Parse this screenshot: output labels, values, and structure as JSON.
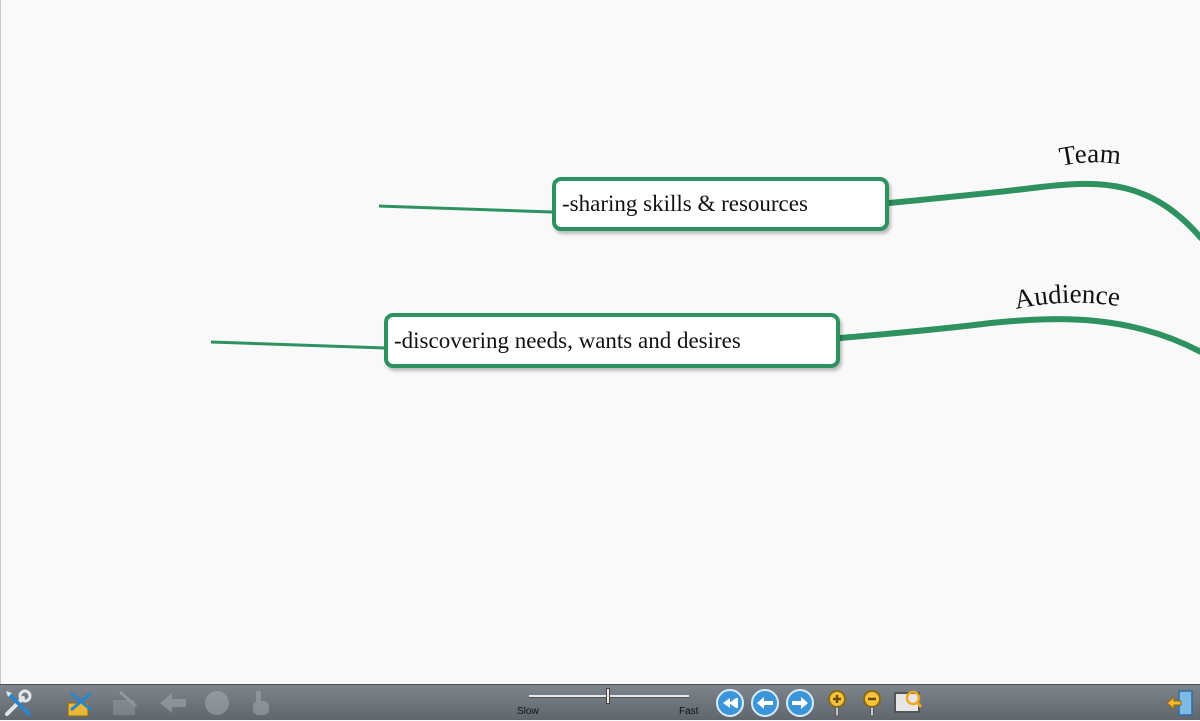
{
  "mindmap": {
    "branches": [
      {
        "label": "Team",
        "subtopic": "-sharing skills & resources"
      },
      {
        "label": "Audience",
        "subtopic": "-discovering needs, wants and desires"
      }
    ],
    "branch_color": "#2e9160"
  },
  "toolbar": {
    "buttons": [
      {
        "icon": "tools-icon"
      },
      {
        "icon": "map-edit-icon"
      },
      {
        "icon": "folder-icon"
      },
      {
        "icon": "arrow-left-icon"
      },
      {
        "icon": "circle-icon"
      },
      {
        "icon": "hand-pointer-icon"
      },
      {
        "icon": "rewind-icon"
      },
      {
        "icon": "back-icon"
      },
      {
        "icon": "forward-icon"
      },
      {
        "icon": "zoom-in-icon"
      },
      {
        "icon": "zoom-out-icon"
      },
      {
        "icon": "fit-screen-icon"
      },
      {
        "icon": "exit-icon"
      }
    ],
    "speed": {
      "slow_label": "Slow",
      "fast_label": "Fast",
      "value": 0.49
    }
  }
}
